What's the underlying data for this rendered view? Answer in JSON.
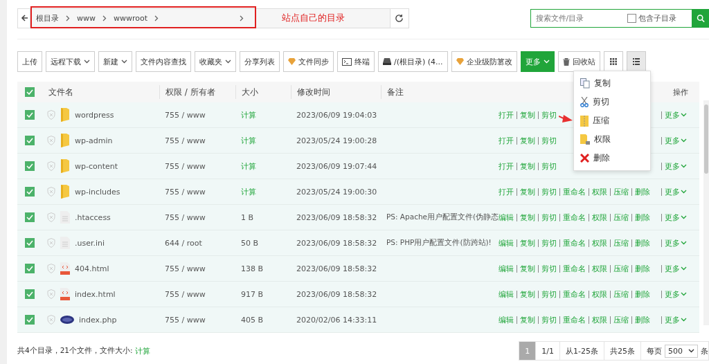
{
  "breadcrumb": {
    "items": [
      "根目录",
      "www",
      "wwwroot"
    ]
  },
  "annotation": {
    "label": "站点自己的目录"
  },
  "search": {
    "placeholder": "搜索文件/目录",
    "subdir": {
      "label": "包含子目录",
      "checked": false
    }
  },
  "toolbar": [
    {
      "label": "上传",
      "kind": "plain"
    },
    {
      "label": "远程下载",
      "kind": "dropdown"
    },
    {
      "label": "新建",
      "kind": "dropdown"
    },
    {
      "label": "文件内容查找",
      "kind": "plain"
    },
    {
      "label": "收藏夹",
      "kind": "dropdown"
    },
    {
      "label": "分享列表",
      "kind": "plain"
    },
    {
      "label": "文件同步",
      "kind": "gem"
    },
    {
      "label": "终端",
      "kind": "terminal"
    },
    {
      "label": "/(根目录) (4...",
      "kind": "disk"
    },
    {
      "label": "企业级防篡改",
      "kind": "gem"
    },
    {
      "label": "更多",
      "kind": "primary"
    },
    {
      "label": "回收站",
      "kind": "trash"
    }
  ],
  "view_modes": [
    {
      "kind": "grid",
      "selected": false
    },
    {
      "kind": "list",
      "selected": true
    }
  ],
  "menu": [
    {
      "label": "复制",
      "kind": "copy"
    },
    {
      "label": "剪切",
      "kind": "cut"
    },
    {
      "label": "压缩",
      "kind": "zip"
    },
    {
      "label": "权限",
      "kind": "perm"
    },
    {
      "label": "删除",
      "kind": "delete"
    }
  ],
  "table": {
    "all_checked": true,
    "columns": [
      "文件名",
      "权限 / 所有者",
      "大小",
      "修改时间",
      "备注",
      "操作"
    ],
    "rows": [
      {
        "checked": true,
        "kind": "folder",
        "name": "wordpress",
        "perm": "755 / www",
        "size": "计算",
        "time": "2023/06/09 19:04:03",
        "note": "",
        "actions": [
          "打开",
          "复制",
          "剪切"
        ],
        "more": "更多"
      },
      {
        "checked": true,
        "kind": "folder",
        "name": "wp-admin",
        "perm": "755 / www",
        "size": "计算",
        "time": "2023/05/24 19:00:28",
        "note": "",
        "actions": [
          "打开",
          "复制",
          "剪切"
        ],
        "more": "更多"
      },
      {
        "checked": true,
        "kind": "folder",
        "name": "wp-content",
        "perm": "755 / www",
        "size": "计算",
        "time": "2023/06/09 19:07:44",
        "note": "",
        "actions": [
          "打开",
          "复制",
          "剪切"
        ],
        "more": "更多"
      },
      {
        "checked": true,
        "kind": "folder",
        "name": "wp-includes",
        "perm": "755 / www",
        "size": "计算",
        "time": "2023/05/24 19:00:30",
        "note": "",
        "actions": [
          "打开",
          "复制",
          "剪切",
          "重命名",
          "权限",
          "压缩",
          "删除"
        ],
        "more": "更多"
      },
      {
        "checked": true,
        "kind": "text",
        "name": ".htaccess",
        "perm": "755 / www",
        "size": "1 B",
        "time": "2023/06/09 18:58:32",
        "note": "PS: Apache用户配置文件(伪静态",
        "actions": [
          "编辑",
          "复制",
          "剪切",
          "重命名",
          "权限",
          "压缩",
          "删除"
        ],
        "more": "更多"
      },
      {
        "checked": true,
        "kind": "text",
        "name": ".user.ini",
        "perm": "644 / root",
        "size": "50 B",
        "time": "2023/06/09 18:58:32",
        "note": "PS: PHP用户配置文件(防跨站)!",
        "actions": [
          "编辑",
          "复制",
          "剪切",
          "重命名",
          "权限",
          "压缩",
          "删除"
        ],
        "more": "更多"
      },
      {
        "checked": true,
        "kind": "html",
        "name": "404.html",
        "perm": "755 / www",
        "size": "138 B",
        "time": "2023/06/09 18:58:32",
        "note": "",
        "actions": [
          "编辑",
          "复制",
          "剪切",
          "重命名",
          "权限",
          "压缩",
          "删除"
        ],
        "more": "更多"
      },
      {
        "checked": true,
        "kind": "html",
        "name": "index.html",
        "perm": "755 / www",
        "size": "917 B",
        "time": "2023/06/09 18:58:32",
        "note": "",
        "actions": [
          "编辑",
          "复制",
          "剪切",
          "重命名",
          "权限",
          "压缩",
          "删除"
        ],
        "more": "更多"
      },
      {
        "checked": true,
        "kind": "php",
        "name": "index.php",
        "perm": "755 / www",
        "size": "405 B",
        "time": "2020/02/06 14:33:11",
        "note": "",
        "actions": [
          "编辑",
          "复制",
          "剪切",
          "重命名",
          "权限",
          "压缩",
          "删除"
        ],
        "more": "更多"
      }
    ]
  },
  "footer": {
    "summary": "共4个目录，21个文件，文件大小:",
    "size_link": "计算"
  },
  "pagination": {
    "pages": [
      {
        "label": "1",
        "selected": true
      }
    ],
    "info": [
      "1/1",
      "从1-25条",
      "共25条"
    ],
    "per_page_label": "每页",
    "per_page": "500",
    "unit": "条"
  }
}
